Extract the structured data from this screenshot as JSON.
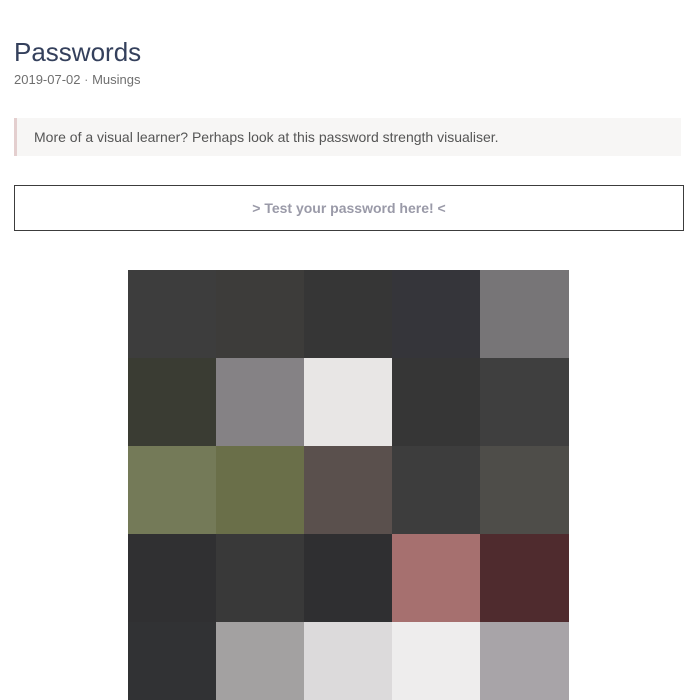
{
  "post": {
    "title": "Passwords",
    "date": "2019-07-02",
    "separator": "·",
    "category": "Musings"
  },
  "callout": {
    "text": "More of a visual learner? Perhaps look at this password strength visualiser."
  },
  "test_button": {
    "label": "> Test your password here! <"
  },
  "pixel_grid": {
    "rows": [
      [
        "#3d3d3d",
        "#3d3c3a",
        "#363636",
        "#35353a",
        "#777577"
      ],
      [
        "#3a3c33",
        "#858285",
        "#e8e6e5",
        "#363636",
        "#3f3f3f"
      ],
      [
        "#747a58",
        "#6a6f49",
        "#5a504d",
        "#3d3d3d",
        "#4e4d49"
      ],
      [
        "#303032",
        "#393939",
        "#2f2f31",
        "#a6706f",
        "#4f2b2e"
      ],
      [
        "#313234",
        "#a3a1a1",
        "#dcdadb",
        "#eeeded",
        "#a8a4a8"
      ]
    ]
  }
}
